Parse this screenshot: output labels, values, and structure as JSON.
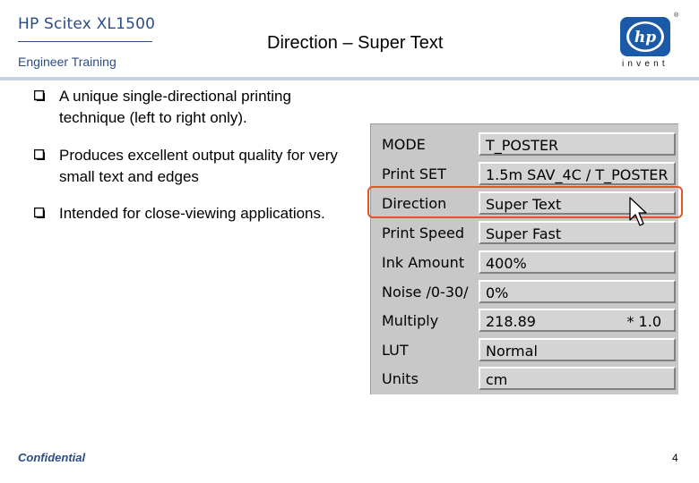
{
  "header": {
    "brand": "HP Scitex XL1500",
    "subtitle": "Engineer  Training",
    "title": "Direction – Super Text",
    "logo_text": "invent"
  },
  "bullets": [
    "A unique single-directional printing technique (left to right only).",
    "Produces excellent output quality for very small text and edges",
    "Intended for close-viewing applications."
  ],
  "settings": [
    {
      "label": "MODE",
      "value": "T_POSTER"
    },
    {
      "label": "Print SET",
      "value": "1.5m SAV_4C / T_POSTER"
    },
    {
      "label": "Direction",
      "value": "Super Text"
    },
    {
      "label": "Print Speed",
      "value": "Super Fast"
    },
    {
      "label": "Ink Amount",
      "value": "400%"
    },
    {
      "label": "Noise /0-30/",
      "value": "0%"
    },
    {
      "label": "Multiply",
      "value": "218.89",
      "extra": "* 1.0"
    },
    {
      "label": "LUT",
      "value": "Normal"
    },
    {
      "label": "Units",
      "value": "cm"
    }
  ],
  "highlighted_setting": "Direction",
  "footer": {
    "confidential": "Confidential",
    "page_number": "4"
  },
  "colors": {
    "brand_blue": "#2d4c86",
    "highlight": "#e2542a",
    "panel_gray": "#c8c8c8"
  }
}
